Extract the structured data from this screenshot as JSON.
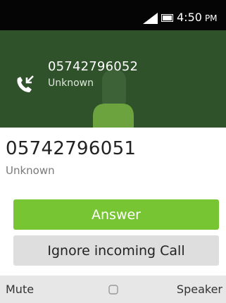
{
  "status_bar": {
    "time": "4:50",
    "ampm": "PM",
    "icons": [
      "signal-icon",
      "battery-icon"
    ]
  },
  "active_call": {
    "number": "05742796052",
    "status": "Unknown",
    "icon": "incoming-call-icon"
  },
  "incoming_call": {
    "number": "05742796051",
    "status": "Unknown"
  },
  "actions": {
    "answer_label": "Answer",
    "ignore_label": "Ignore incoming Call"
  },
  "softkeys": {
    "left": "Mute",
    "center_icon": "select-icon",
    "right": "Speaker"
  },
  "colors": {
    "status_bar": "#050505",
    "active_call_bg": "#2f522b",
    "answer": "#77c533",
    "ignore": "#dedede",
    "softkey_bar": "#e8e7e8"
  }
}
